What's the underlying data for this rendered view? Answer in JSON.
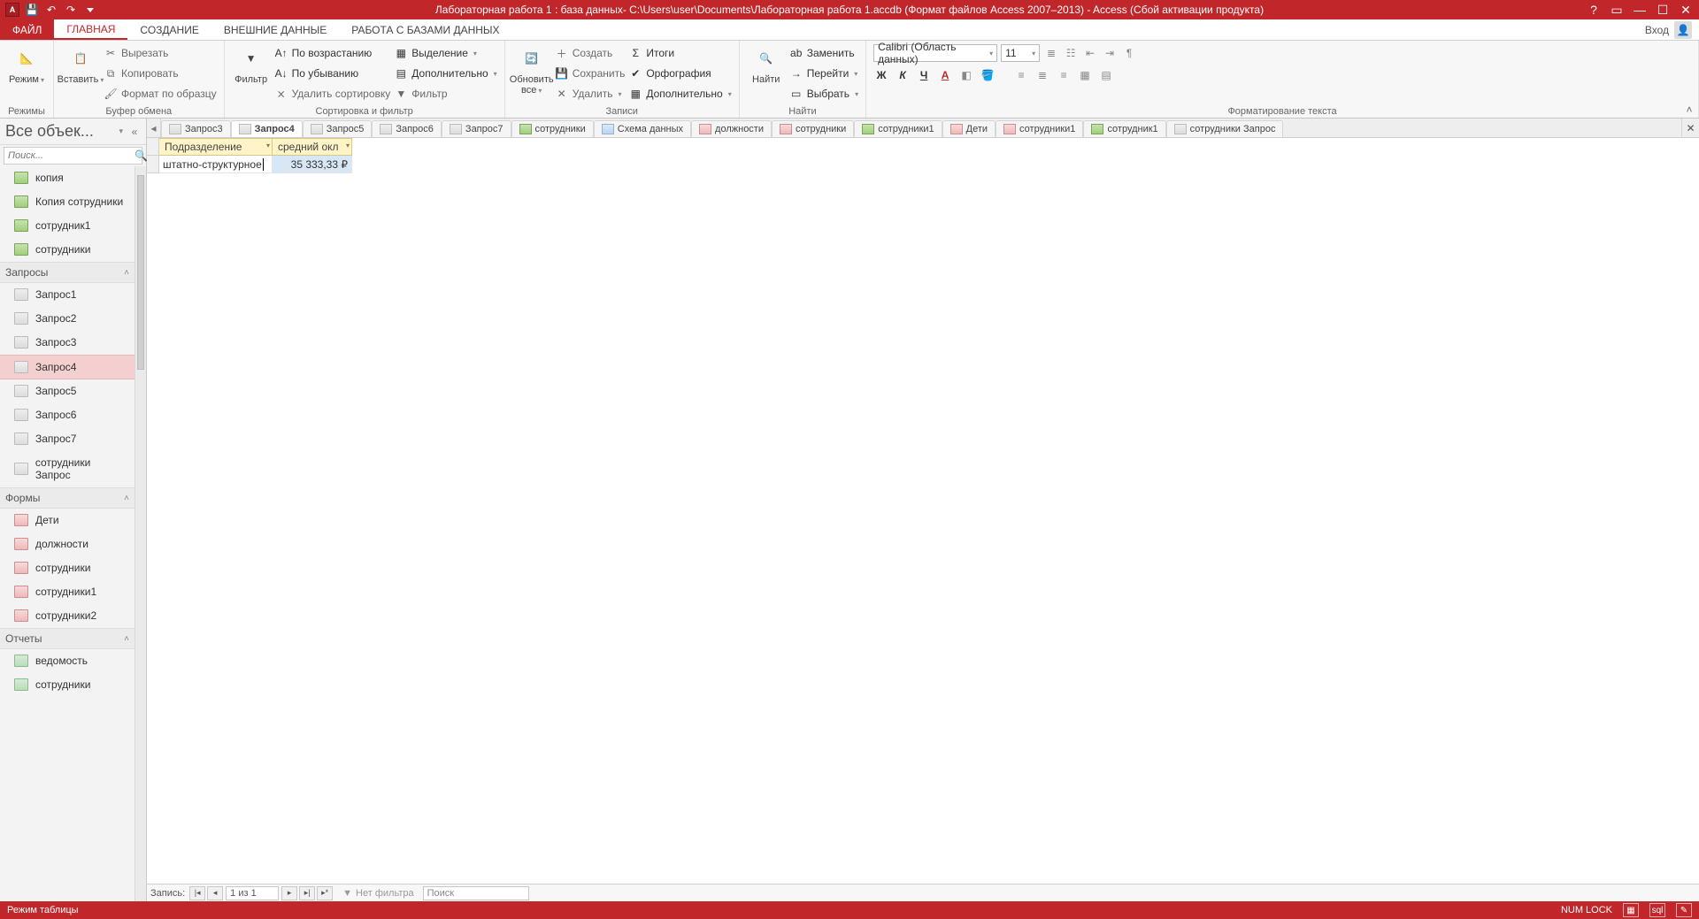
{
  "colors": {
    "accent": "#c1262a"
  },
  "titlebar": {
    "title": "Лабораторная работа 1 : база данных- C:\\Users\\user\\Documents\\Лабораторная работа 1.accdb (Формат файлов Access 2007–2013) -  Access (Сбой активации продукта)"
  },
  "ribbon_tabs": {
    "file": "ФАЙЛ",
    "tabs": [
      "ГЛАВНАЯ",
      "СОЗДАНИЕ",
      "ВНЕШНИЕ ДАННЫЕ",
      "РАБОТА С БАЗАМИ ДАННЫХ"
    ],
    "active": "ГЛАВНАЯ",
    "login": "Вход"
  },
  "ribbon": {
    "views": {
      "button": "Режим",
      "group": "Режимы"
    },
    "clipboard": {
      "paste": "Вставить",
      "cut": "Вырезать",
      "copy": "Копировать",
      "format_painter": "Формат по образцу",
      "group": "Буфер обмена"
    },
    "sortfilter": {
      "filter": "Фильтр",
      "asc": "По возрастанию",
      "desc": "По убыванию",
      "remove_sort": "Удалить сортировку",
      "selection": "Выделение",
      "advanced": "Дополнительно",
      "toggle_filter": "Фильтр",
      "group": "Сортировка и фильтр"
    },
    "records": {
      "refresh": "Обновить все",
      "new": "Создать",
      "save": "Сохранить",
      "delete": "Удалить",
      "totals": "Итоги",
      "spelling": "Орфография",
      "more": "Дополнительно",
      "group": "Записи"
    },
    "find": {
      "find": "Найти",
      "replace": "Заменить",
      "goto": "Перейти",
      "select": "Выбрать",
      "group": "Найти"
    },
    "textfmt": {
      "font_name": "Calibri (Область данных)",
      "font_size": "11",
      "bold": "Ж",
      "italic": "К",
      "underline": "Ч",
      "group": "Форматирование текста"
    }
  },
  "nav": {
    "title": "Все объек...",
    "search_placeholder": "Поиск...",
    "tables_visible": [
      "копия",
      "Копия сотрудники",
      "сотрудник1",
      "сотрудники"
    ],
    "cat_queries": "Запросы",
    "queries": [
      "Запрос1",
      "Запрос2",
      "Запрос3",
      "Запрос4",
      "Запрос5",
      "Запрос6",
      "Запрос7",
      "сотрудники Запрос"
    ],
    "selected_query": "Запрос4",
    "cat_forms": "Формы",
    "forms": [
      "Дети",
      "должности",
      "сотрудники",
      "сотрудники1",
      "сотрудники2"
    ],
    "cat_reports": "Отчеты",
    "reports": [
      "ведомость",
      "сотрудники"
    ]
  },
  "doc_tabs": {
    "items": [
      {
        "label": "Запрос3",
        "kind": "query"
      },
      {
        "label": "Запрос4",
        "kind": "query",
        "active": true
      },
      {
        "label": "Запрос5",
        "kind": "query"
      },
      {
        "label": "Запрос6",
        "kind": "query"
      },
      {
        "label": "Запрос7",
        "kind": "query"
      },
      {
        "label": "сотрудники",
        "kind": "table"
      },
      {
        "label": "Схема данных",
        "kind": "rel"
      },
      {
        "label": "должности",
        "kind": "form"
      },
      {
        "label": "сотрудники",
        "kind": "form"
      },
      {
        "label": "сотрудники1",
        "kind": "table"
      },
      {
        "label": "Дети",
        "kind": "form"
      },
      {
        "label": "сотрудники1",
        "kind": "form"
      },
      {
        "label": "сотрудник1",
        "kind": "table"
      },
      {
        "label": "сотрудники Запрос",
        "kind": "query"
      }
    ]
  },
  "datasheet": {
    "columns": [
      "Подразделение",
      "средний окл"
    ],
    "rows": [
      {
        "c1": "штатно-структурное",
        "c2": "35 333,33 ₽"
      }
    ]
  },
  "recnav": {
    "label": "Запись:",
    "pos": "1 из 1",
    "no_filter": "Нет фильтра",
    "search": "Поиск"
  },
  "statusbar": {
    "mode": "Режим таблицы",
    "numlock": "NUM LOCK"
  }
}
